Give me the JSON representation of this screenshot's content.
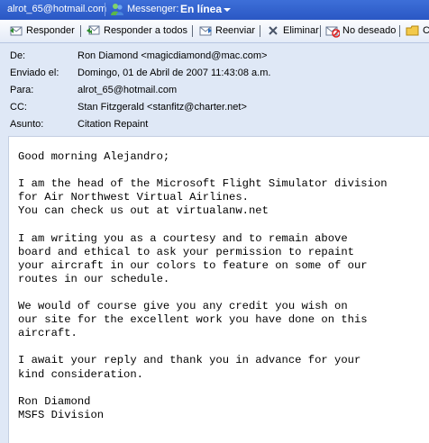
{
  "topbar": {
    "email": "alrot_65@hotmail.com",
    "messenger_label": "Messenger:",
    "status": "En línea"
  },
  "toolbar": {
    "reply": "Responder",
    "reply_all": "Responder a todos",
    "forward": "Reenviar",
    "delete": "Eliminar",
    "junk": "No deseado",
    "partial": "C"
  },
  "header": {
    "from_label": "De:",
    "from_value": "Ron Diamond <magicdiamond@mac.com>",
    "sent_label": "Enviado el:",
    "sent_value": "Domingo, 01 de Abril de 2007 11:43:08 a.m.",
    "to_label": "Para:",
    "to_value": "alrot_65@hotmail.com",
    "cc_label": "CC:",
    "cc_value": "Stan Fitzgerald <stanfitz@charter.net>",
    "subject_label": "Asunto:",
    "subject_value": "Citation Repaint"
  },
  "message": {
    "greeting": "Good morning Alejandro;",
    "p1": "I am the head of the Microsoft Flight Simulator division\nfor Air Northwest Virtual Airlines.\nYou can check us out at virtualanw.net",
    "p2": "I am writing you as a courtesy and to remain above\nboard and ethical to ask your permission to repaint\nyour aircraft in our colors to feature on some of our\nroutes in our schedule.",
    "p3": "We would of course give you any credit you wish on\nour site for the excellent work you have done on this\naircraft.",
    "p4": "I await your reply and thank you in advance for your\nkind consideration.",
    "signature": "Ron Diamond\nMSFS Division"
  }
}
